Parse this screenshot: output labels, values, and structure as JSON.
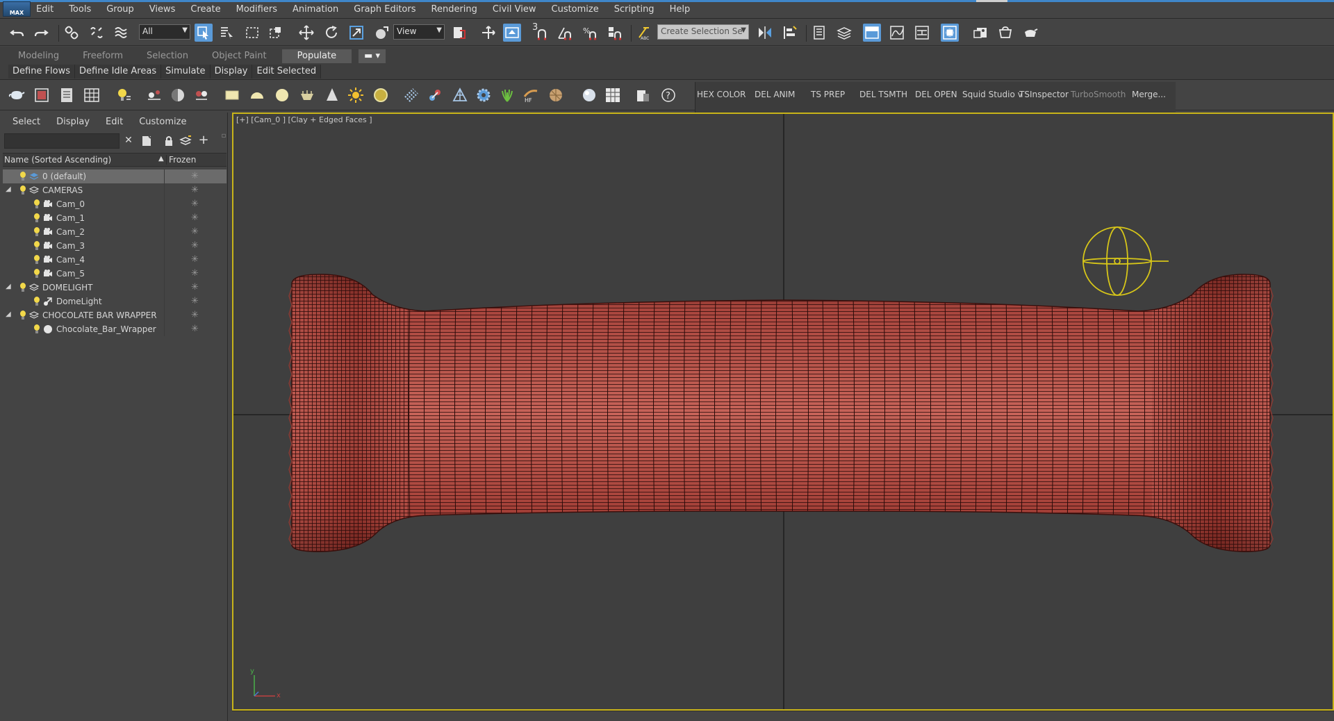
{
  "app": {
    "logo_text": "MAX"
  },
  "menu": [
    "Edit",
    "Tools",
    "Group",
    "Views",
    "Create",
    "Modifiers",
    "Animation",
    "Graph Editors",
    "Rendering",
    "Civil View",
    "Customize",
    "Scripting",
    "Help"
  ],
  "toolbar": {
    "selection_filter": "All",
    "reference_coord": "View",
    "named_selection_placeholder": "Create Selection Se",
    "snap_label": "3"
  },
  "ribbon": {
    "tabs": [
      "Modeling",
      "Freeform",
      "Selection",
      "Object Paint",
      "Populate"
    ],
    "active_tab": "Populate",
    "commands": [
      "Define Flows",
      "Define Idle Areas",
      "Simulate",
      "Display",
      "Edit Selected"
    ]
  },
  "scripts_toolbar": [
    "HEX COLOR",
    "DEL ANIM",
    "TS PREP",
    "DEL TSMTH",
    "DEL OPEN",
    "Squid Studio v",
    "TSInspector",
    "TurboSmooth",
    "Merge..."
  ],
  "explorer": {
    "menu": [
      "Select",
      "Display",
      "Edit",
      "Customize"
    ],
    "columns": {
      "name": "Name (Sorted Ascending)",
      "frozen": "Frozen"
    },
    "rows": [
      {
        "label": "0 (default)",
        "type": "layer",
        "level": 0,
        "selected": true
      },
      {
        "label": "CAMERAS",
        "type": "layer",
        "level": 0,
        "expanded": true
      },
      {
        "label": "Cam_0",
        "type": "camera",
        "level": 1
      },
      {
        "label": "Cam_1",
        "type": "camera",
        "level": 1
      },
      {
        "label": "Cam_2",
        "type": "camera",
        "level": 1
      },
      {
        "label": "Cam_3",
        "type": "camera",
        "level": 1
      },
      {
        "label": "Cam_4",
        "type": "camera",
        "level": 1
      },
      {
        "label": "Cam_5",
        "type": "camera",
        "level": 1
      },
      {
        "label": "DOMELIGHT",
        "type": "layer",
        "level": 0,
        "expanded": true
      },
      {
        "label": "DomeLight",
        "type": "light",
        "level": 1
      },
      {
        "label": "CHOCOLATE BAR WRAPPER",
        "type": "layer",
        "level": 0,
        "expanded": true
      },
      {
        "label": "Chocolate_Bar_Wrapper",
        "type": "geometry",
        "level": 1
      }
    ]
  },
  "viewport": {
    "label": "[+] [Cam_0 ] [Clay + Edged Faces ]",
    "active_border_color": "#c8b419",
    "mesh_color": "#b5554c",
    "gizmo_color": "#d7c619",
    "axis_labels": {
      "y": "y",
      "x": "x"
    }
  }
}
